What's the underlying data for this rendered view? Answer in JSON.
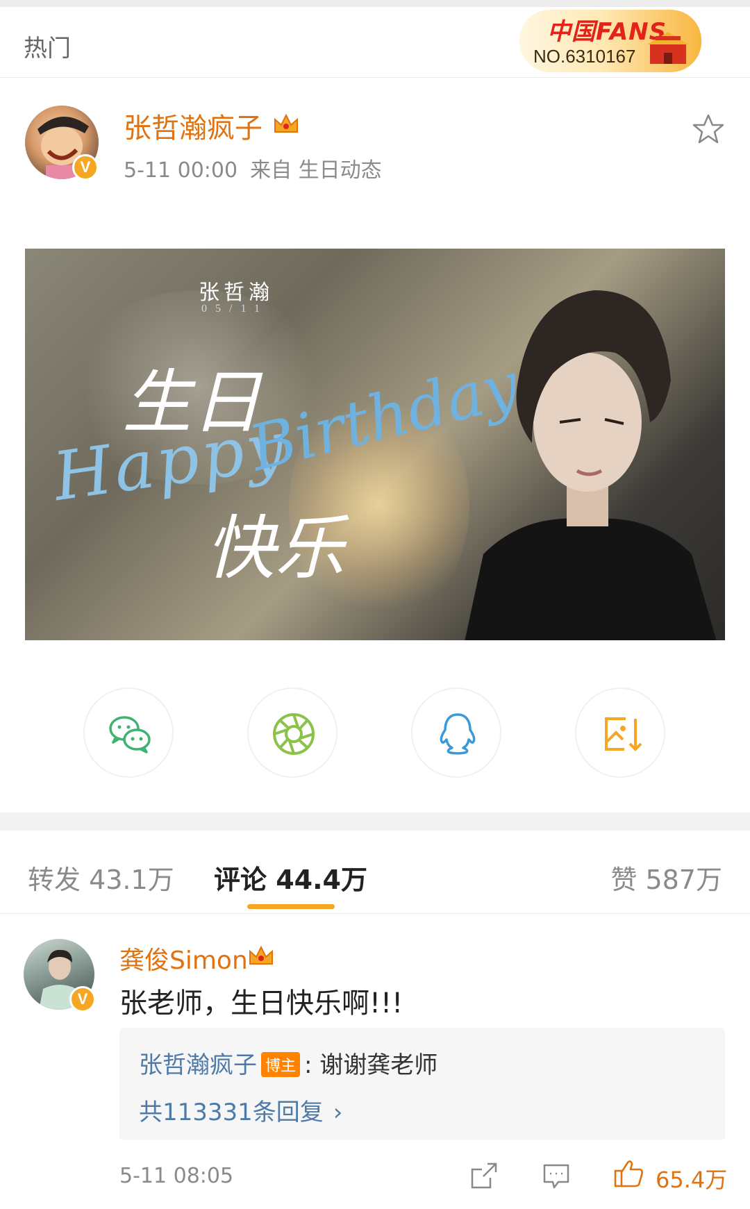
{
  "header": {
    "section_title": "热门",
    "fans_badge": {
      "logo_text": "中国FANS",
      "number": "NO.6310167"
    }
  },
  "post": {
    "author": "张哲瀚疯子",
    "time": "5-11 00:00",
    "source": "来自 生日动态",
    "image": {
      "name_text": "张哲瀚",
      "date_text": "05/11",
      "cn_line1": "生日",
      "cn_line2": "快乐",
      "en_happy": "Happy",
      "en_birthday": "Birthday"
    }
  },
  "share": {
    "icons": [
      "wechat-icon",
      "moments-icon",
      "qq-icon",
      "save-image-icon"
    ],
    "colors": {
      "wechat": "#3cb371",
      "moments": "#8bc34a",
      "qq": "#3a9ad9",
      "save": "#f5a623"
    }
  },
  "tabs": {
    "repost": "转发 43.1万",
    "comment": "评论 44.4万",
    "like": "赞 587万",
    "indicator_color": "#f5a623"
  },
  "comment": {
    "user": "龚俊Simon",
    "text": "张老师，生日快乐啊!!!",
    "reply": {
      "author": "张哲瀚疯子",
      "tag": "博主",
      "text": ": 谢谢龚老师",
      "count": "共113331条回复"
    },
    "time": "5-11 08:05",
    "likes": "65.4万"
  },
  "colors": {
    "accent": "#e2720f",
    "link": "#4f7aa8",
    "badge": "#f5a623"
  }
}
